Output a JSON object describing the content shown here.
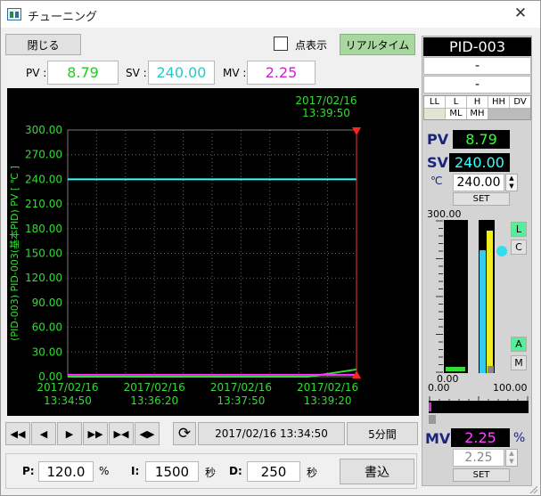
{
  "window": {
    "title": "チューニング",
    "close_glyph": "✕"
  },
  "toolbar": {
    "close_label": "閉じる",
    "point_display_label": "点表示",
    "realtime_label": "リアルタイム"
  },
  "readout": {
    "pv_label": "PV :",
    "pv_value": "8.79",
    "sv_label": "SV :",
    "sv_value": "240.00",
    "mv_label": "MV :",
    "mv_value": "2.25"
  },
  "chart_data": {
    "type": "line",
    "title": "",
    "cursor_label_date": "2017/02/16",
    "cursor_label_time": "13:39:50",
    "ylabel": "(PID-003) PID-003(基本PID) PV [ ℃ ]",
    "ylim": [
      0,
      300
    ],
    "yticks": [
      "300.00",
      "270.00",
      "240.00",
      "210.00",
      "180.00",
      "150.00",
      "120.00",
      "90.00",
      "60.00",
      "30.00",
      "0.00"
    ],
    "xticks": [
      {
        "date": "2017/02/16",
        "time": "13:34:50"
      },
      {
        "date": "2017/02/16",
        "time": "13:36:20"
      },
      {
        "date": "2017/02/16",
        "time": "13:37:50"
      },
      {
        "date": "2017/02/16",
        "time": "13:39:20"
      }
    ],
    "grid": true,
    "series": [
      {
        "key": "sv",
        "color": "#33ffff",
        "x": [
          "13:34:50",
          "13:39:50"
        ],
        "y": [
          240,
          240
        ]
      },
      {
        "key": "pv",
        "color": "#33dd33",
        "x": [
          "13:34:50",
          "13:39:00",
          "13:39:50"
        ],
        "y": [
          0,
          0,
          8.79
        ]
      },
      {
        "key": "mv",
        "color": "#ff33ff",
        "x": [
          "13:34:50",
          "13:39:00",
          "13:39:50"
        ],
        "y": [
          2.25,
          2.25,
          2.25
        ]
      }
    ]
  },
  "nav": {
    "datetime": "2017/02/16 13:34:50",
    "span": "5分間",
    "buttons": [
      "◀◀",
      "◀",
      "▶",
      "▶▶",
      "▶◀",
      "◀▶"
    ]
  },
  "pid": {
    "p_label": "P:",
    "p_value": "120.0",
    "p_unit": "%",
    "i_label": "I:",
    "i_value": "1500",
    "i_unit": "秒",
    "d_label": "D:",
    "d_value": "250",
    "d_unit": "秒",
    "write_label": "書込"
  },
  "right": {
    "tag": "PID-003",
    "line1": "-",
    "line2": "-",
    "alarm_top": [
      "LL",
      "L",
      "H",
      "HH"
    ],
    "alarm_bottom": [
      "DV",
      "",
      "ML",
      "MH"
    ],
    "pv_label": "PV",
    "pv_value": "8.79",
    "sv_label": "SV",
    "sv_value": "240.00",
    "unit": "℃",
    "sv_input": "240.00",
    "set_label": "SET",
    "bar_max": "300.00",
    "bar_min": "0.00",
    "pv_fraction": 0.029,
    "sv_fraction": 0.8,
    "mv_fraction": 0.0225,
    "mode_l": "L",
    "mode_c": "C",
    "mode_a": "A",
    "mode_m": "M",
    "mv_scale_min": "0.00",
    "mv_scale_max": "100.00",
    "mv_label": "MV",
    "mv_value": "2.25",
    "mv_unit": "%",
    "mv_input": "2.25",
    "mv_set_label": "SET"
  }
}
